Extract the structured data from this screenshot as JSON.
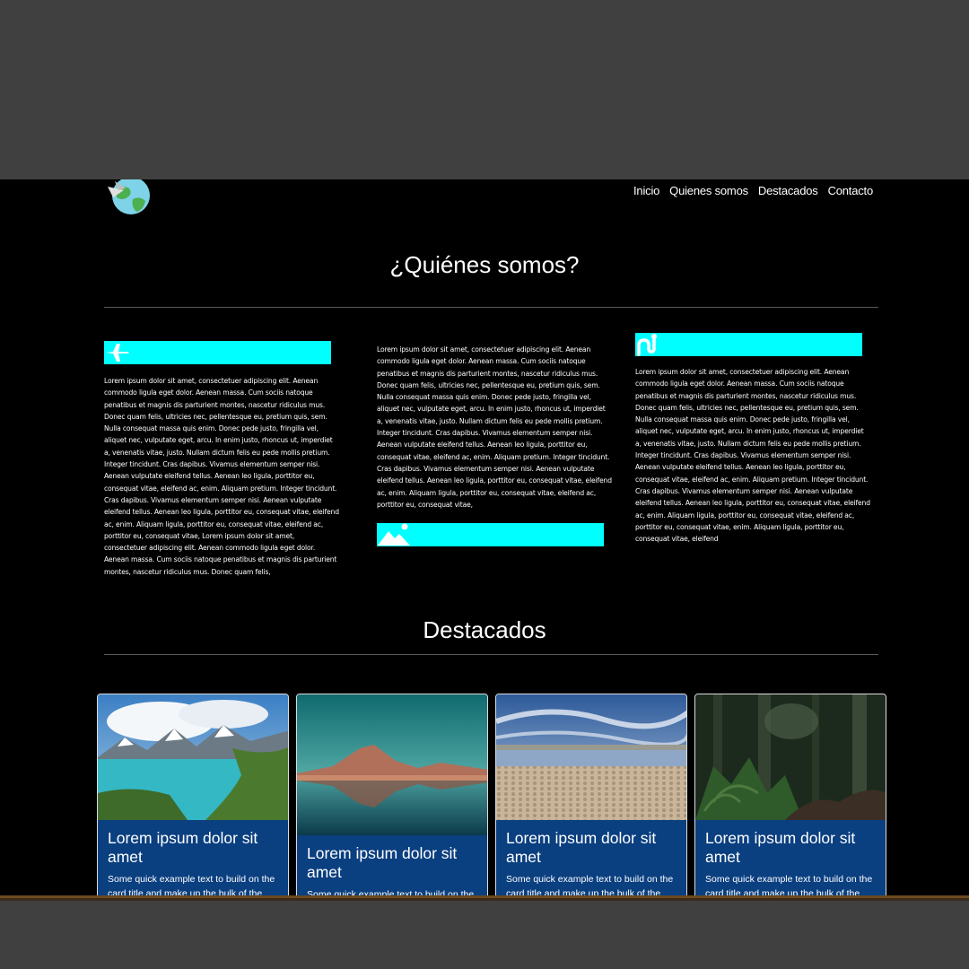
{
  "nav": {
    "items": [
      "Inicio",
      "Quienes somos",
      "Destacados",
      "Contacto"
    ]
  },
  "about": {
    "title": "¿Quiénes somos?",
    "col1_text": "Lorem ipsum dolor sit amet, consectetuer adipiscing elit. Aenean commodo ligula eget dolor. Aenean massa. Cum sociis natoque penatibus et magnis dis parturient montes, nascetur ridiculus mus. Donec quam felis, ultricies nec, pellentesque eu, pretium quis, sem. Nulla consequat massa quis enim. Donec pede justo, fringilla vel, aliquet nec, vulputate eget, arcu. In enim justo, rhoncus ut, imperdiet a, venenatis vitae, justo. Nullam dictum felis eu pede mollis pretium. Integer tincidunt. Cras dapibus. Vivamus elementum semper nisi. Aenean vulputate eleifend tellus. Aenean leo ligula, porttitor eu, consequat vitae, eleifend ac, enim. Aliquam pretium. Integer tincidunt. Cras dapibus. Vivamus elementum semper nisi. Aenean vulputate eleifend tellus. Aenean leo ligula, porttitor eu, consequat vitae, eleifend ac, enim. Aliquam ligula, porttitor eu, consequat vitae, eleifend ac, porttitor eu, consequat vitae, Lorem ipsum dolor sit amet, consectetuer adipiscing elit. Aenean commodo ligula eget dolor. Aenean massa. Cum sociis natoque penatibus et magnis dis parturient montes, nascetur ridiculus mus. Donec quam felis,",
    "col2_text": "Lorem ipsum dolor sit amet, consectetuer adipiscing elit. Aenean commodo ligula eget dolor. Aenean massa. Cum sociis natoque penatibus et magnis dis parturient montes, nascetur ridiculus mus. Donec quam felis, ultricies nec, pellentesque eu, pretium quis, sem. Nulla consequat massa quis enim. Donec pede justo, fringilla vel, aliquet nec, vulputate eget, arcu. In enim justo, rhoncus ut, imperdiet a, venenatis vitae, justo. Nullam dictum felis eu pede mollis pretium. Integer tincidunt. Cras dapibus. Vivamus elementum semper nisi. Aenean vulputate eleifend tellus. Aenean leo ligula, porttitor eu, consequat vitae, eleifend ac, enim. Aliquam pretium. Integer tincidunt. Cras dapibus. Vivamus elementum semper nisi. Aenean vulputate eleifend tellus. Aenean leo ligula, porttitor eu, consequat vitae, eleifend ac, enim. Aliquam ligula, porttitor eu, consequat vitae, eleifend ac, porttitor eu, consequat vitae,",
    "col3_text": "Lorem ipsum dolor sit amet, consectetuer adipiscing elit. Aenean commodo ligula eget dolor. Aenean massa. Cum sociis natoque penatibus et magnis dis parturient montes, nascetur ridiculus mus. Donec quam felis, ultricies nec, pellentesque eu, pretium quis, sem. Nulla consequat massa quis enim. Donec pede justo, fringilla vel, aliquet nec, vulputate eget, arcu. In enim justo, rhoncus ut, imperdiet a, venenatis vitae, justo. Nullam dictum felis eu pede mollis pretium. Integer tincidunt. Cras dapibus. Vivamus elementum semper nisi. Aenean vulputate eleifend tellus. Aenean leo ligula, porttitor eu, consequat vitae, eleifend ac, enim. Aliquam pretium. Integer tincidunt. Cras dapibus. Vivamus elementum semper nisi. Aenean vulputate eleifend tellus. Aenean leo ligula, porttitor eu, consequat vitae, eleifend ac, enim. Aliquam ligula, porttitor eu, consequat vitae, eleifend ac, porttitor eu, consequat vitae, enim. Aliquam ligula, porttitor eu, consequat vitae, eleifend",
    "icons": [
      "airplane-icon",
      "route-icon",
      "mountain-icon"
    ],
    "accent_color": "#00ffff"
  },
  "featured": {
    "title": "Destacados",
    "cards": [
      {
        "title": "Lorem ipsum dolor sit amet",
        "text": "Some quick example text to build on the card title and make up the bulk of the"
      },
      {
        "title": "Lorem ipsum dolor sit amet",
        "text": "Some quick example text to build on the"
      },
      {
        "title": "Lorem ipsum dolor sit amet",
        "text": "Some quick example text to build on the card title and make up the bulk of the"
      },
      {
        "title": "Lorem ipsum dolor sit amet",
        "text": "Some quick example text to build on the card title and make up the bulk of the"
      }
    ],
    "card_color": "#0a3f80"
  }
}
